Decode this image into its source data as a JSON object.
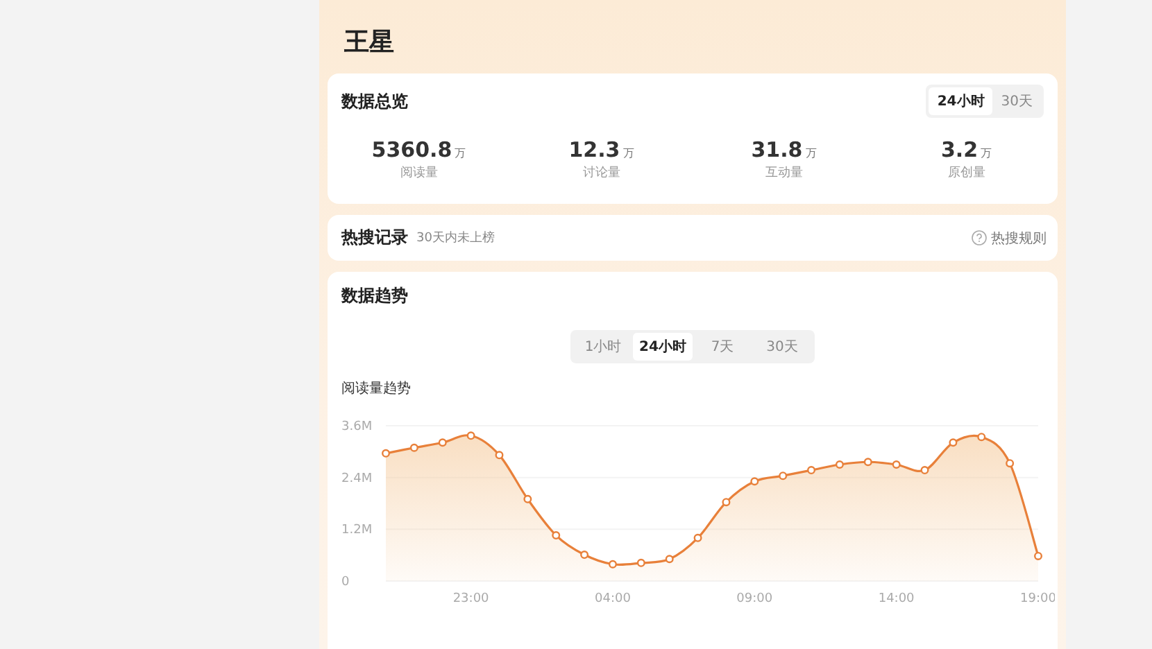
{
  "title": "王星",
  "overview": {
    "title": "数据总览",
    "ranges": [
      {
        "label": "24小时",
        "selected": true
      },
      {
        "label": "30天",
        "selected": false
      }
    ],
    "stats": [
      {
        "value": "5360.8",
        "unit": "万",
        "label": "阅读量"
      },
      {
        "value": "12.3",
        "unit": "万",
        "label": "讨论量"
      },
      {
        "value": "31.8",
        "unit": "万",
        "label": "互动量"
      },
      {
        "value": "3.2",
        "unit": "万",
        "label": "原创量"
      }
    ]
  },
  "hot_search": {
    "title": "热搜记录",
    "note": "30天内未上榜",
    "rules_link": "热搜规则"
  },
  "trend": {
    "title": "数据趋势",
    "ranges": [
      {
        "label": "1小时",
        "selected": false
      },
      {
        "label": "24小时",
        "selected": true
      },
      {
        "label": "7天",
        "selected": false
      },
      {
        "label": "30天",
        "selected": false
      }
    ],
    "subtitle": "阅读量趋势",
    "chart_data": {
      "type": "area",
      "categories": [
        null,
        null,
        null,
        "23:00",
        null,
        null,
        null,
        null,
        "04:00",
        null,
        null,
        null,
        null,
        "09:00",
        null,
        null,
        null,
        null,
        "14:00",
        null,
        null,
        null,
        null,
        "19:00"
      ],
      "series": [
        {
          "color": "#e8803a",
          "values": [
            2.96,
            3.09,
            3.21,
            3.37,
            2.92,
            1.9,
            1.06,
            0.61,
            0.39,
            0.42,
            0.51,
            1.0,
            1.83,
            2.31,
            2.44,
            2.57,
            2.7,
            2.76,
            2.7,
            2.57,
            3.21,
            3.34,
            2.73,
            0.58
          ]
        }
      ],
      "ylim": [
        0,
        3.6
      ],
      "yticks": [
        {
          "value": 0,
          "label": "0"
        },
        {
          "value": 1.2,
          "label": "1.2M"
        },
        {
          "value": 2.4,
          "label": "2.4M"
        },
        {
          "value": 3.6,
          "label": "3.6M"
        }
      ]
    }
  }
}
